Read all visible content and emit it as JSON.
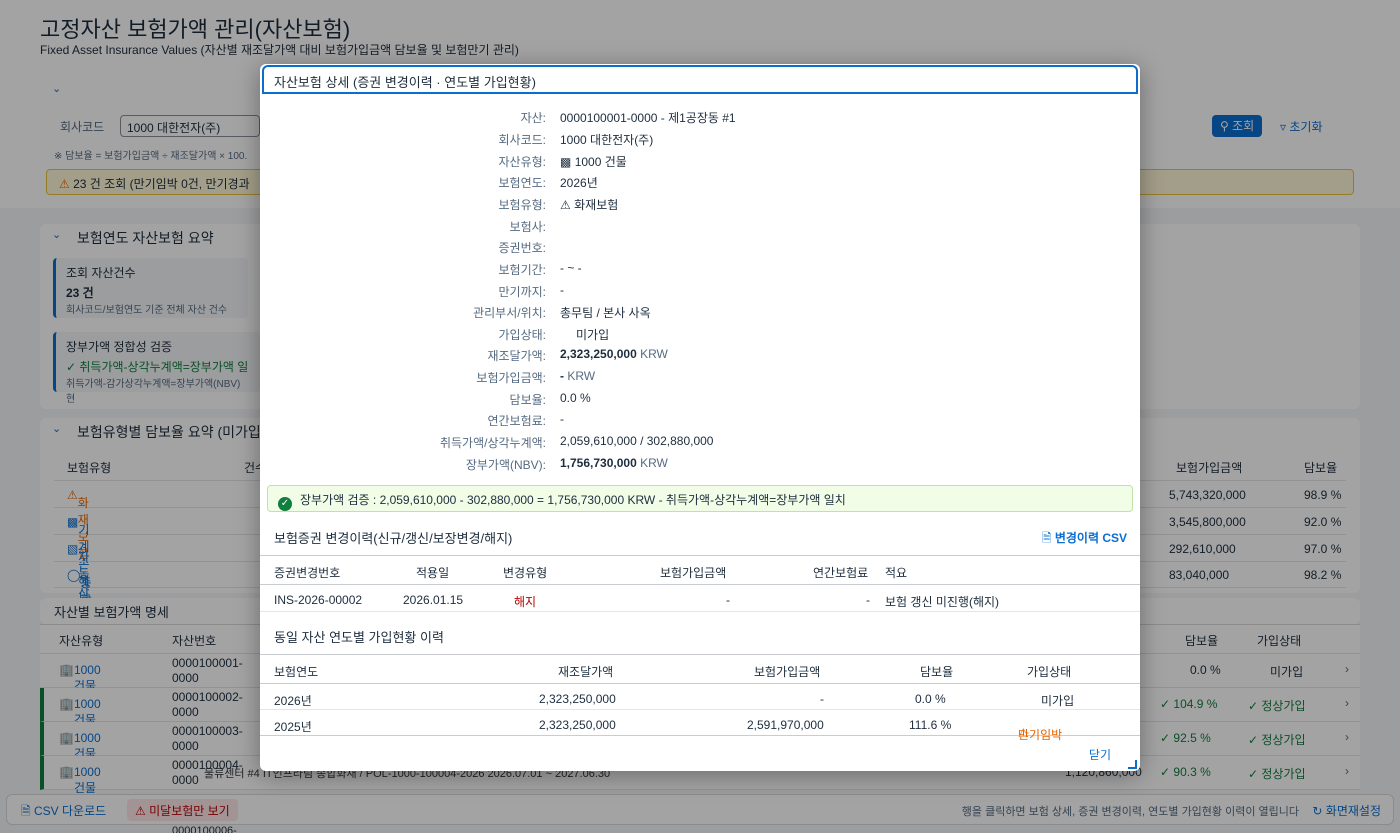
{
  "header": {
    "title": "고정자산 보험가액 관리(자산보험)",
    "subtitle": "Fixed Asset Insurance Values (자산별 재조달가액 대비 보험가입금액 담보율 및 보험만기 관리)"
  },
  "filter": {
    "company_label": "회사코드",
    "company_value": "1000 대한전자(주)",
    "note": "※ 담보율 = 보험가입금액 ÷ 재조달가액 × 100.",
    "search_button": "조회",
    "reset_button": "초기화"
  },
  "warning_bar": "23 건 조회 (만기임박 0건, 만기경과",
  "summary": {
    "title": "보험연도 자산보험 요약",
    "card1_title": "조회 자산건수",
    "card1_value": "23 건",
    "card1_note": "회사코드/보험연도 기준 전체 자산 건수",
    "card2_title": "장부가액 정합성 검증",
    "card2_value": "✓ 취득가액-상각누계액=장부가액 일",
    "card2_note": "취득가액-감가상각누계액=장부가액(NBV) 현"
  },
  "type_summary": {
    "title": "보험유형별 담보율 요약 (미가입",
    "col_type": "보험유형",
    "col_count": "건수",
    "col_amount": "보험가입금액",
    "col_ratio": "담보율",
    "rows": [
      {
        "name": "화재보험",
        "amount": "5,743,320,000",
        "ratio": "98.9 %"
      },
      {
        "name": "기계손해보험",
        "amount": "3,545,800,000",
        "ratio": "92.0 %"
      },
      {
        "name": "자동차보험",
        "amount": "292,610,000",
        "ratio": "97.0 %"
      },
      {
        "name": "종합재산보험",
        "amount": "83,040,000",
        "ratio": "98.2 %"
      }
    ]
  },
  "asset_list": {
    "title": "자산별 보험가액 명세",
    "col_type": "자산유형",
    "col_no": "자산번호",
    "col_ratio": "담보율",
    "col_status": "가입상태",
    "rows": [
      {
        "type": "1000 건물",
        "no1": "0000100001-",
        "no2": "0000",
        "ratio": "0.0 %",
        "status": "미가입",
        "extra": ""
      },
      {
        "type": "1000 건물",
        "no1": "0000100002-",
        "no2": "0000",
        "ratio": "✓ 104.9 %",
        "status": "✓ 정상가입",
        "extra": ""
      },
      {
        "type": "1000 건물",
        "no1": "0000100003-",
        "no2": "0000",
        "ratio": "✓ 92.5 %",
        "status": "✓ 정상가입",
        "extra": ""
      },
      {
        "type": "1000 건물",
        "no1": "0000100004-",
        "no2": "0000",
        "ratio": "✓ 90.3 %",
        "status": "✓ 정상가입",
        "extra": "1,120,860,000"
      }
    ],
    "partial_row": "물류센터 #4          IT인프라팀          종합화재 / POL-1000-100004-2026                    2026.07.01 ~ 2027.06.30",
    "next_no": "0000100006-"
  },
  "footer": {
    "csv_button": "CSV 다운로드",
    "unpaid_toggle": "미달보험만 보기",
    "hint": "행을 클릭하면 보험 상세, 증권 변경이력, 연도별 가입현황 이력이 열립니다",
    "reset_layout": "화면재설정"
  },
  "dialog": {
    "title": "자산보험 상세 (증권 변경이력 · 연도별 가입현황)",
    "fields": [
      {
        "label": "자산:",
        "value": "0000100001-0000 - 제1공장동 #1"
      },
      {
        "label": "회사코드:",
        "value": "1000 대한전자(주)"
      },
      {
        "label": "자산유형:",
        "value": "1000 건물"
      },
      {
        "label": "보험연도:",
        "value": "2026년"
      },
      {
        "label": "보험유형:",
        "value": "화재보험"
      },
      {
        "label": "보험사:",
        "value": ""
      },
      {
        "label": "증권번호:",
        "value": ""
      },
      {
        "label": "보험기간:",
        "value": "- ~ -"
      },
      {
        "label": "만기까지:",
        "value": "-"
      },
      {
        "label": "관리부서/위치:",
        "value": "총무팀 / 본사 사옥"
      },
      {
        "label": "가입상태:",
        "value": "미가입"
      },
      {
        "label": "재조달가액:",
        "value": "2,323,250,000",
        "unit": "KRW"
      },
      {
        "label": "보험가입금액:",
        "value": "-",
        "unit": "KRW"
      },
      {
        "label": "담보율:",
        "value": "0.0 %"
      },
      {
        "label": "연간보험료:",
        "value": "-"
      },
      {
        "label": "취득가액/상각누계액:",
        "value": "2,059,610,000 / 302,880,000"
      },
      {
        "label": "장부가액(NBV):",
        "value": "1,756,730,000",
        "unit": "KRW"
      }
    ],
    "check_message": "장부가액 검증 : 2,059,610,000 - 302,880,000 = 1,756,730,000 KRW - 취득가액-상각누계액=장부가액 일치",
    "history_title": "보험증권 변경이력(신규/갱신/보장변경/해지)",
    "history_csv": "변경이력 CSV",
    "history_cols": [
      "증권변경번호",
      "적용일",
      "변경유형",
      "보험가입금액",
      "연간보험료",
      "적요"
    ],
    "history_rows": [
      {
        "no": "INS-2026-00002",
        "date": "2026.01.15",
        "type": "해지",
        "amount": "-",
        "premium": "-",
        "memo": "보험 갱신 미진행(해지)"
      }
    ],
    "yearly_title": "동일 자산 연도별 가입현황 이력",
    "yearly_cols": [
      "보험연도",
      "재조달가액",
      "보험가입금액",
      "담보율",
      "가입상태"
    ],
    "yearly_rows": [
      {
        "year": "2026년",
        "replace": "2,323,250,000",
        "amount": "-",
        "ratio": "0.0 %",
        "status": "미가입"
      },
      {
        "year": "2025년",
        "replace": "2,323,250,000",
        "amount": "2,591,970,000",
        "ratio": "111.6 %",
        "status": "만기임박"
      }
    ],
    "close_button": "닫기"
  },
  "colors": {
    "accent": "#0a6ed1",
    "warning": "#e76500",
    "success": "#107e3e",
    "error": "#bb0000"
  }
}
